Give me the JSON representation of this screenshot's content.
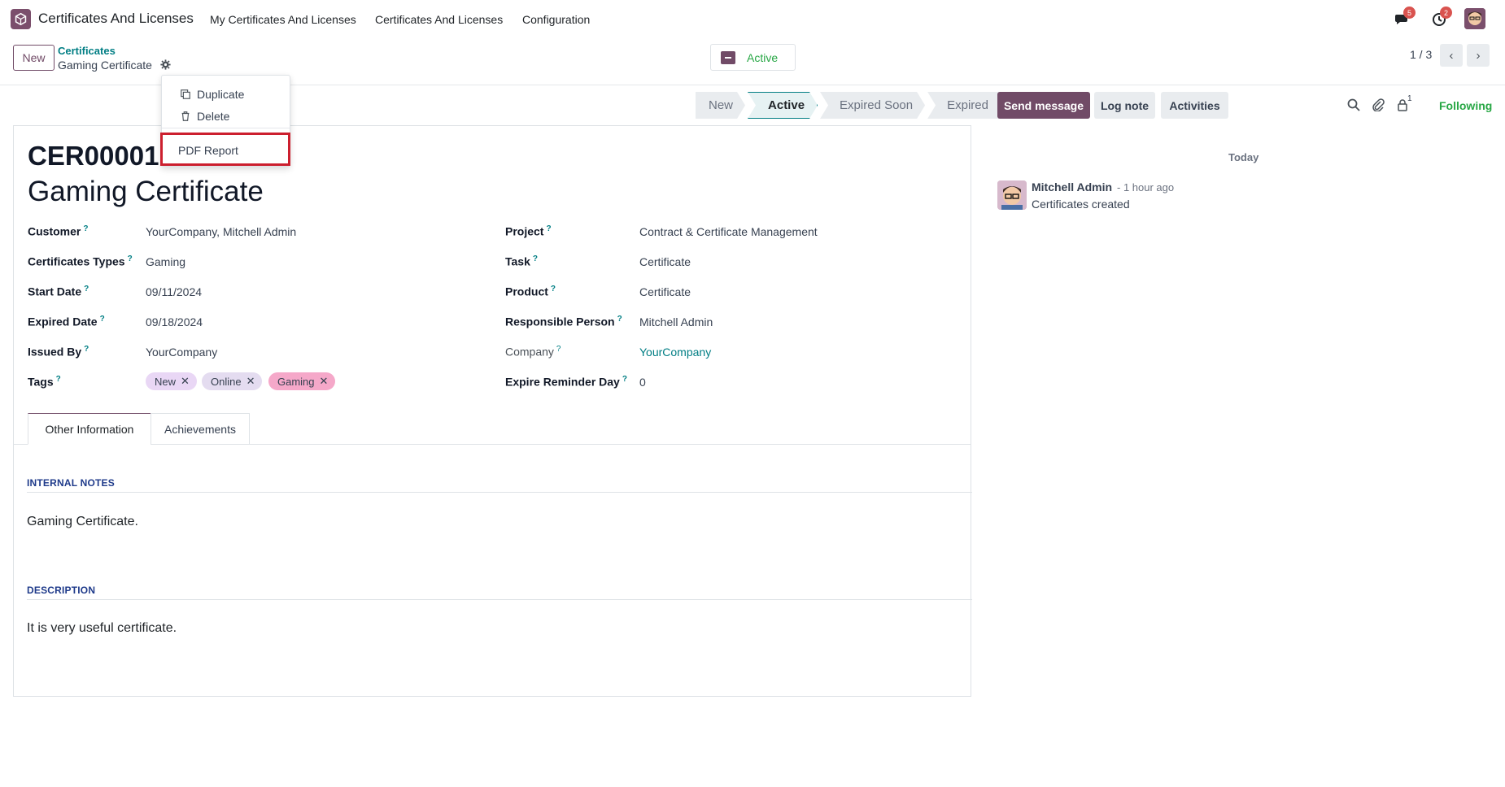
{
  "navbar": {
    "app_name": "Certificates And Licenses",
    "menu": [
      "My Certificates And Licenses",
      "Certificates And Licenses",
      "Configuration"
    ],
    "messages_badge": "5",
    "activities_badge": "2"
  },
  "control": {
    "new_label": "New",
    "breadcrumb_parent": "Certificates",
    "breadcrumb_current": "Gaming Certificate",
    "active_label": "Active",
    "pager": "1 / 3"
  },
  "gear_menu": {
    "duplicate": "Duplicate",
    "delete": "Delete",
    "pdf_report": "PDF Report"
  },
  "status_bar": [
    "New",
    "Active",
    "Expired Soon",
    "Expired"
  ],
  "record": {
    "reference": "CER00001",
    "name": "Gaming Certificate",
    "left_fields": [
      {
        "label": "Customer",
        "value": "YourCompany, Mitchell Admin"
      },
      {
        "label": "Certificates Types",
        "value": "Gaming"
      },
      {
        "label": "Start Date",
        "value": "09/11/2024"
      },
      {
        "label": "Expired Date",
        "value": "09/18/2024"
      },
      {
        "label": "Issued By",
        "value": "YourCompany"
      },
      {
        "label": "Tags",
        "value": ""
      }
    ],
    "right_fields": [
      {
        "label": "Project",
        "value": "Contract & Certificate Management"
      },
      {
        "label": "Task",
        "value": "Certificate"
      },
      {
        "label": "Product",
        "value": "Certificate"
      },
      {
        "label": "Responsible Person",
        "value": "Mitchell Admin"
      },
      {
        "label": "Company",
        "value": "YourCompany"
      },
      {
        "label": "Expire Reminder Day",
        "value": "0"
      }
    ],
    "tags": [
      {
        "label": "New",
        "color": "#e9d7f5"
      },
      {
        "label": "Online",
        "color": "#e4dcf0"
      },
      {
        "label": "Gaming",
        "color": "#f5a8c9"
      }
    ],
    "help_mark": "?",
    "tabs": [
      "Other Information",
      "Achievements"
    ],
    "internal_notes_heading": "INTERNAL NOTES",
    "internal_notes": "Gaming Certificate.",
    "description_heading": "DESCRIPTION",
    "description": "It is very useful certificate."
  },
  "chatter": {
    "send_message": "Send message",
    "log_note": "Log note",
    "activities": "Activities",
    "followers_count": "1",
    "following": "Following",
    "day_separator": "Today",
    "message": {
      "author": "Mitchell Admin",
      "time": "- 1 hour ago",
      "body": "Certificates created"
    }
  },
  "colors": {
    "brand": "#714b67",
    "teal": "#017e84",
    "success": "#28a745",
    "highlight_box": "#cc1f2e"
  }
}
